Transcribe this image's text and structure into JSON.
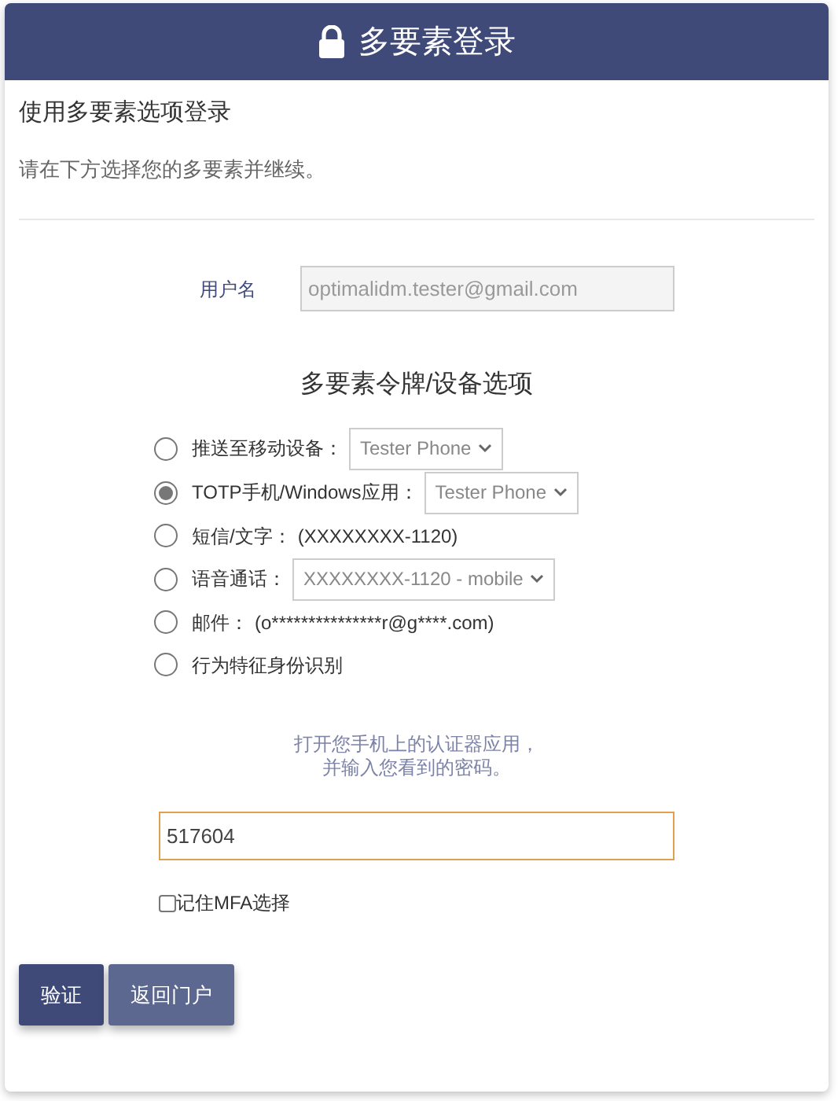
{
  "header": {
    "title": "多要素登录"
  },
  "subtitle": "使用多要素选项登录",
  "description": "请在下方选择您的多要素并继续。",
  "username": {
    "label": "用户名",
    "value": "optimalidm.tester@gmail.com",
    "disabled": true
  },
  "options_title": "多要素令牌/设备选项",
  "options": [
    {
      "kind": "select",
      "label": "推送至移动设备：",
      "value": "Tester Phone",
      "selected": false
    },
    {
      "kind": "select",
      "label": "TOTP手机/Windows应用：",
      "value": "Tester Phone",
      "selected": true
    },
    {
      "kind": "text",
      "label": "短信/文字：",
      "detail": "(XXXXXXXX-1120)",
      "selected": false
    },
    {
      "kind": "select",
      "label": "语音通话：",
      "value": "XXXXXXXX-1120 - mobile",
      "selected": false
    },
    {
      "kind": "text",
      "label": "邮件：",
      "detail": "(o***************r@g****.com)",
      "selected": false
    },
    {
      "kind": "plain",
      "label": "行为特征身份识别",
      "selected": false
    }
  ],
  "hint": [
    "打开您手机上的认证器应用，",
    "并输入您看到的密码。"
  ],
  "code_field": {
    "value": "517604",
    "focused": true
  },
  "remember": {
    "label": "记住MFA选择",
    "checked": false
  },
  "buttons": [
    {
      "kind": "primary",
      "label": "验证"
    },
    {
      "kind": "secondary",
      "label": "返回门户"
    }
  ]
}
